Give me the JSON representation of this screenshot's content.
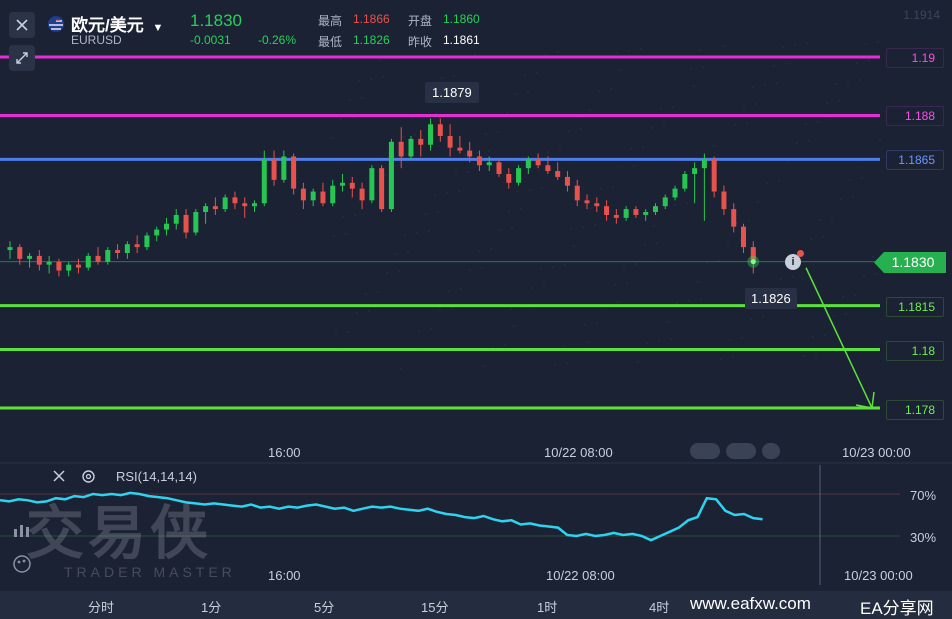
{
  "header": {
    "pair_name": "欧元/美元",
    "symbol": "EURUSD",
    "last_price": "1.1830",
    "change": "-0.0031",
    "change_pct": "-0.26%",
    "high_label": "最高",
    "high_value": "1.1866",
    "low_label": "最低",
    "low_value": "1.1826",
    "open_label": "开盘",
    "open_value": "1.1860",
    "prev_close_label": "昨收",
    "prev_close_value": "1.1861",
    "faded_price": "1.1914"
  },
  "price_scale": {
    "levels": [
      {
        "label": "1.19",
        "color": "#e62ed6"
      },
      {
        "label": "1.188",
        "color": "#e62ed6"
      },
      {
        "label": "1.1865",
        "color": "#4f7ee8"
      },
      {
        "label": "1.1815",
        "color": "#5ce13a"
      },
      {
        "label": "1.18",
        "color": "#5ce13a"
      },
      {
        "label": "1.178",
        "color": "#5ce13a"
      }
    ],
    "current_price": "1.1830",
    "faded_label": "1.1815"
  },
  "annotations": {
    "peak_label": "1.1879",
    "trough_label": "1.1826"
  },
  "time_axis": {
    "main_labels": [
      "16:00",
      "10/22 08:00",
      "10/23 00:00"
    ],
    "rsi_labels": [
      "16:00",
      "10/22 08:00",
      "10/23 00:00"
    ]
  },
  "rsi": {
    "title": "RSI(14,14,14)",
    "level_high": "70%",
    "level_low": "30%"
  },
  "periods": [
    "分时",
    "1分",
    "5分",
    "15分",
    "1时",
    "4时"
  ],
  "watermarks": {
    "brand_cn": "交易侠",
    "brand_en": "TRADER MASTER",
    "site": "www.eafxw.com",
    "site2": "EA分享网"
  },
  "colors": {
    "up": "#26c653",
    "down": "#e8524c",
    "background": "#1b2234",
    "rsi_line": "#2ed3f0"
  },
  "chart_data": {
    "type": "candlestick",
    "series": [
      {
        "name": "EURUSD",
        "ohlc": [
          [
            1.1834,
            1.1837,
            1.1831,
            1.1835
          ],
          [
            1.1835,
            1.1836,
            1.1829,
            1.1831
          ],
          [
            1.1831,
            1.1833,
            1.1828,
            1.1832
          ],
          [
            1.1832,
            1.1834,
            1.1827,
            1.1829
          ],
          [
            1.1829,
            1.1832,
            1.1826,
            1.183
          ],
          [
            1.183,
            1.1831,
            1.1825,
            1.1827
          ],
          [
            1.1827,
            1.183,
            1.1825,
            1.1829
          ],
          [
            1.1829,
            1.1831,
            1.1826,
            1.1828
          ],
          [
            1.1828,
            1.1833,
            1.1827,
            1.1832
          ],
          [
            1.1832,
            1.1835,
            1.1829,
            1.183
          ],
          [
            1.183,
            1.1835,
            1.1829,
            1.1834
          ],
          [
            1.1834,
            1.1836,
            1.1831,
            1.1833
          ],
          [
            1.1833,
            1.1837,
            1.1831,
            1.1836
          ],
          [
            1.1836,
            1.1839,
            1.1833,
            1.1835
          ],
          [
            1.1835,
            1.184,
            1.1834,
            1.1839
          ],
          [
            1.1839,
            1.1842,
            1.1837,
            1.1841
          ],
          [
            1.1841,
            1.1845,
            1.1839,
            1.1843
          ],
          [
            1.1843,
            1.1848,
            1.1841,
            1.1846
          ],
          [
            1.1846,
            1.1848,
            1.1838,
            1.184
          ],
          [
            1.184,
            1.1848,
            1.1839,
            1.1847
          ],
          [
            1.1847,
            1.185,
            1.1843,
            1.1849
          ],
          [
            1.1849,
            1.1852,
            1.1846,
            1.1848
          ],
          [
            1.1848,
            1.1853,
            1.1847,
            1.1852
          ],
          [
            1.1852,
            1.1854,
            1.1848,
            1.185
          ],
          [
            1.185,
            1.1852,
            1.1845,
            1.1849
          ],
          [
            1.1849,
            1.1851,
            1.1847,
            1.185
          ],
          [
            1.185,
            1.1868,
            1.1849,
            1.1865
          ],
          [
            1.1865,
            1.1868,
            1.1856,
            1.1858
          ],
          [
            1.1858,
            1.1868,
            1.1857,
            1.1866
          ],
          [
            1.1866,
            1.1867,
            1.1853,
            1.1855
          ],
          [
            1.1855,
            1.1857,
            1.1848,
            1.1851
          ],
          [
            1.1851,
            1.1855,
            1.1849,
            1.1854
          ],
          [
            1.1854,
            1.1857,
            1.1849,
            1.185
          ],
          [
            1.185,
            1.1858,
            1.1849,
            1.1856
          ],
          [
            1.1856,
            1.186,
            1.1854,
            1.1857
          ],
          [
            1.1857,
            1.1859,
            1.1852,
            1.1855
          ],
          [
            1.1855,
            1.1857,
            1.1848,
            1.1851
          ],
          [
            1.1851,
            1.1863,
            1.185,
            1.1862
          ],
          [
            1.1862,
            1.1863,
            1.1847,
            1.1848
          ],
          [
            1.1848,
            1.1872,
            1.1847,
            1.1871
          ],
          [
            1.1871,
            1.1876,
            1.1862,
            1.1866
          ],
          [
            1.1866,
            1.1873,
            1.1865,
            1.1872
          ],
          [
            1.1872,
            1.1875,
            1.1866,
            1.187
          ],
          [
            1.187,
            1.1879,
            1.1868,
            1.1877
          ],
          [
            1.1877,
            1.1879,
            1.1871,
            1.1873
          ],
          [
            1.1873,
            1.1877,
            1.1866,
            1.1869
          ],
          [
            1.1869,
            1.1873,
            1.1867,
            1.1868
          ],
          [
            1.1868,
            1.1871,
            1.1864,
            1.1866
          ],
          [
            1.1866,
            1.1868,
            1.1861,
            1.1863
          ],
          [
            1.1863,
            1.1866,
            1.1861,
            1.1864
          ],
          [
            1.1864,
            1.1865,
            1.1859,
            1.186
          ],
          [
            1.186,
            1.1862,
            1.1855,
            1.1857
          ],
          [
            1.1857,
            1.1863,
            1.1856,
            1.1862
          ],
          [
            1.1862,
            1.1866,
            1.186,
            1.1865
          ],
          [
            1.1865,
            1.1867,
            1.1862,
            1.1863
          ],
          [
            1.1863,
            1.1866,
            1.186,
            1.1861
          ],
          [
            1.1861,
            1.1864,
            1.1858,
            1.1859
          ],
          [
            1.1859,
            1.1861,
            1.1854,
            1.1856
          ],
          [
            1.1856,
            1.1858,
            1.1849,
            1.1851
          ],
          [
            1.1851,
            1.1853,
            1.1848,
            1.185
          ],
          [
            1.185,
            1.1852,
            1.1847,
            1.1849
          ],
          [
            1.1849,
            1.1851,
            1.1844,
            1.1846
          ],
          [
            1.1846,
            1.1848,
            1.1843,
            1.1845
          ],
          [
            1.1845,
            1.1849,
            1.1844,
            1.1848
          ],
          [
            1.1848,
            1.1849,
            1.1845,
            1.1846
          ],
          [
            1.1846,
            1.1848,
            1.1844,
            1.1847
          ],
          [
            1.1847,
            1.185,
            1.1846,
            1.1849
          ],
          [
            1.1849,
            1.1853,
            1.1848,
            1.1852
          ],
          [
            1.1852,
            1.1856,
            1.1851,
            1.1855
          ],
          [
            1.1855,
            1.1861,
            1.1854,
            1.186
          ],
          [
            1.186,
            1.1864,
            1.185,
            1.1862
          ],
          [
            1.1862,
            1.1867,
            1.1844,
            1.1865
          ],
          [
            1.1865,
            1.1866,
            1.1852,
            1.1854
          ],
          [
            1.1854,
            1.1856,
            1.1846,
            1.1848
          ],
          [
            1.1848,
            1.185,
            1.184,
            1.1842
          ],
          [
            1.1842,
            1.1843,
            1.1833,
            1.1835
          ],
          [
            1.1835,
            1.1837,
            1.1826,
            1.183
          ]
        ]
      }
    ],
    "ylim": [
      1.1775,
      1.1905
    ],
    "horizontal_levels": [
      1.19,
      1.188,
      1.1865,
      1.1815,
      1.18,
      1.178
    ],
    "forecast_arrow": {
      "from": 1.183,
      "to": 1.178
    },
    "rsi_values": [
      64,
      63,
      65,
      64,
      62,
      63,
      66,
      65,
      68,
      67,
      70,
      69,
      70,
      69,
      71,
      70,
      68,
      67,
      66,
      64,
      62,
      61,
      60,
      61,
      60,
      59,
      58,
      60,
      57,
      58,
      56,
      58,
      57,
      59,
      60,
      58,
      56,
      57,
      54,
      56,
      58,
      57,
      58,
      56,
      55,
      54,
      56,
      53,
      51,
      50,
      48,
      47,
      49,
      46,
      44,
      45,
      41,
      42,
      40,
      39,
      38,
      31,
      30,
      32,
      30,
      31,
      33,
      31,
      32,
      30,
      26,
      30,
      34,
      38,
      45,
      48,
      66,
      65,
      54,
      50,
      51,
      47,
      46
    ],
    "rsi_levels": [
      70,
      30
    ]
  }
}
